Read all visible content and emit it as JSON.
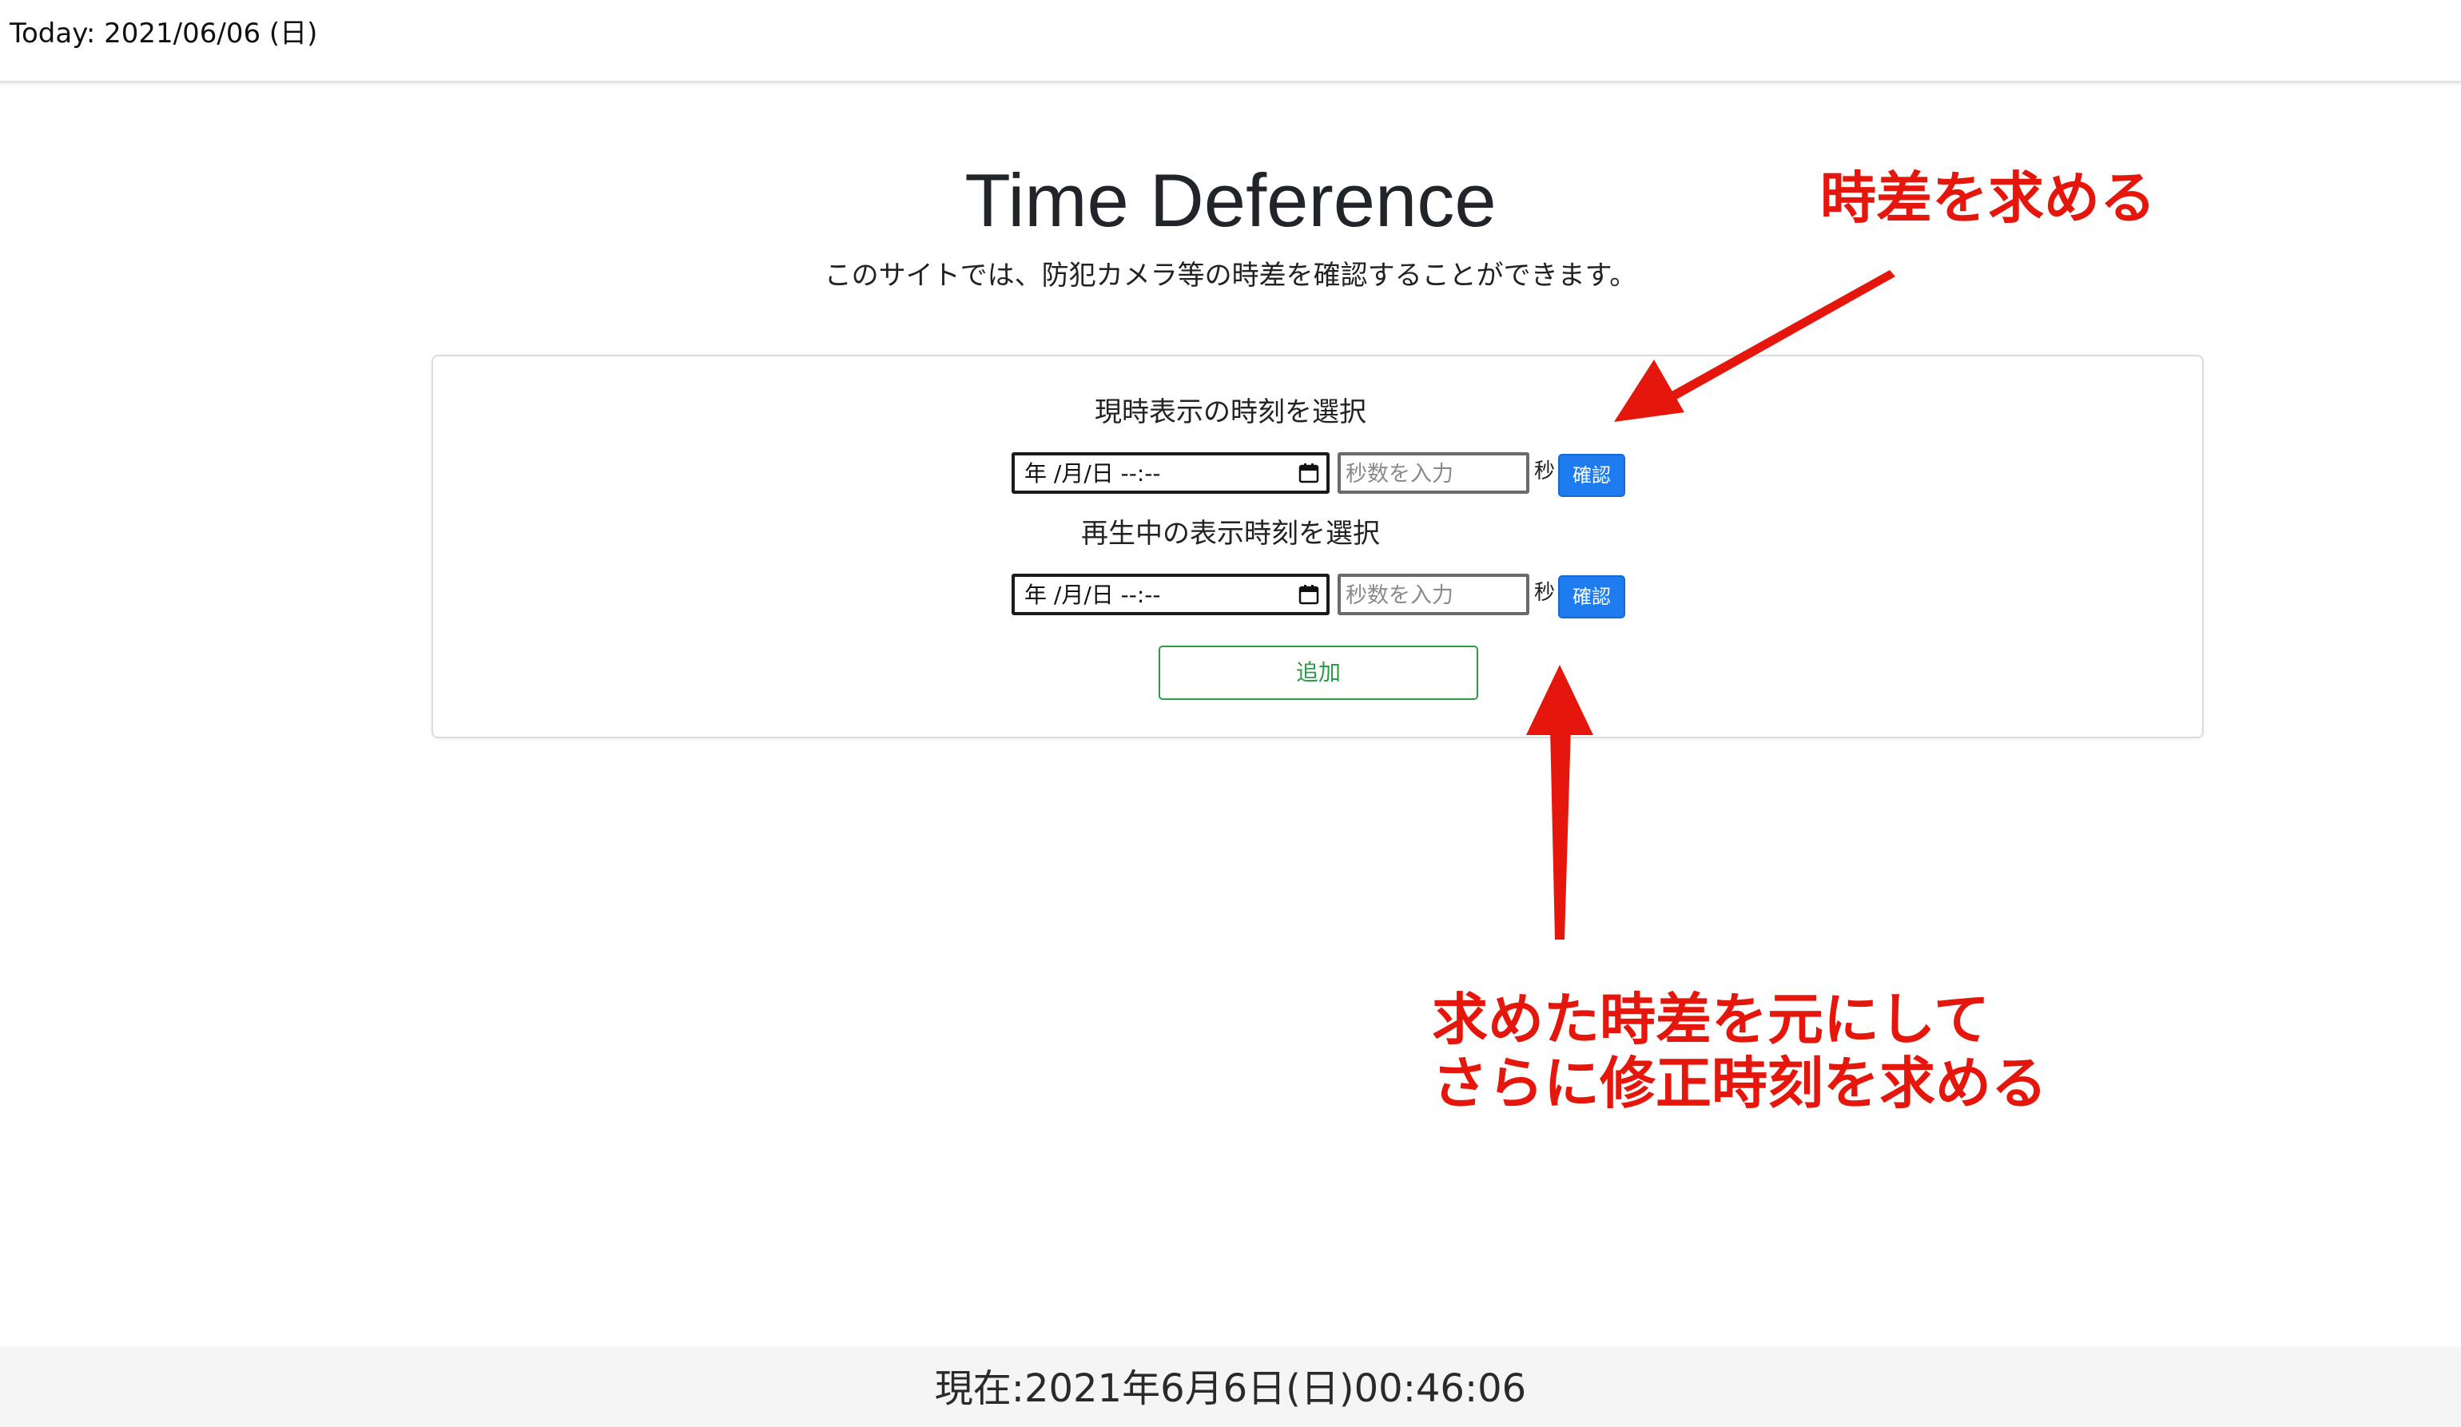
{
  "header": {
    "today": "Today: 2021/06/06 (日)"
  },
  "main": {
    "title": "Time Deference",
    "subtitle": "このサイトでは、防犯カメラ等の時差を確認することができます。"
  },
  "form": {
    "sections": [
      {
        "label": "現時表示の時刻を選択",
        "datetime_value": "年 /月/日  --:--",
        "seconds_placeholder": "秒数を入力",
        "unit": "秒",
        "confirm_label": "確認"
      },
      {
        "label": "再生中の表示時刻を選択",
        "datetime_value": "年 /月/日  --:--",
        "seconds_placeholder": "秒数を入力",
        "unit": "秒",
        "confirm_label": "確認"
      }
    ],
    "add_label": "追加"
  },
  "annotations": {
    "top": "時差を求める",
    "bottom_line1": "求めた時差を元にして",
    "bottom_line2": "さらに修正時刻を求める",
    "color": "#e5170c"
  },
  "footer": {
    "now": "現在:2021年6月6日(日)00:46:06"
  },
  "colors": {
    "confirm_button": "#1f7cf0",
    "add_button": "#2e9a46"
  }
}
